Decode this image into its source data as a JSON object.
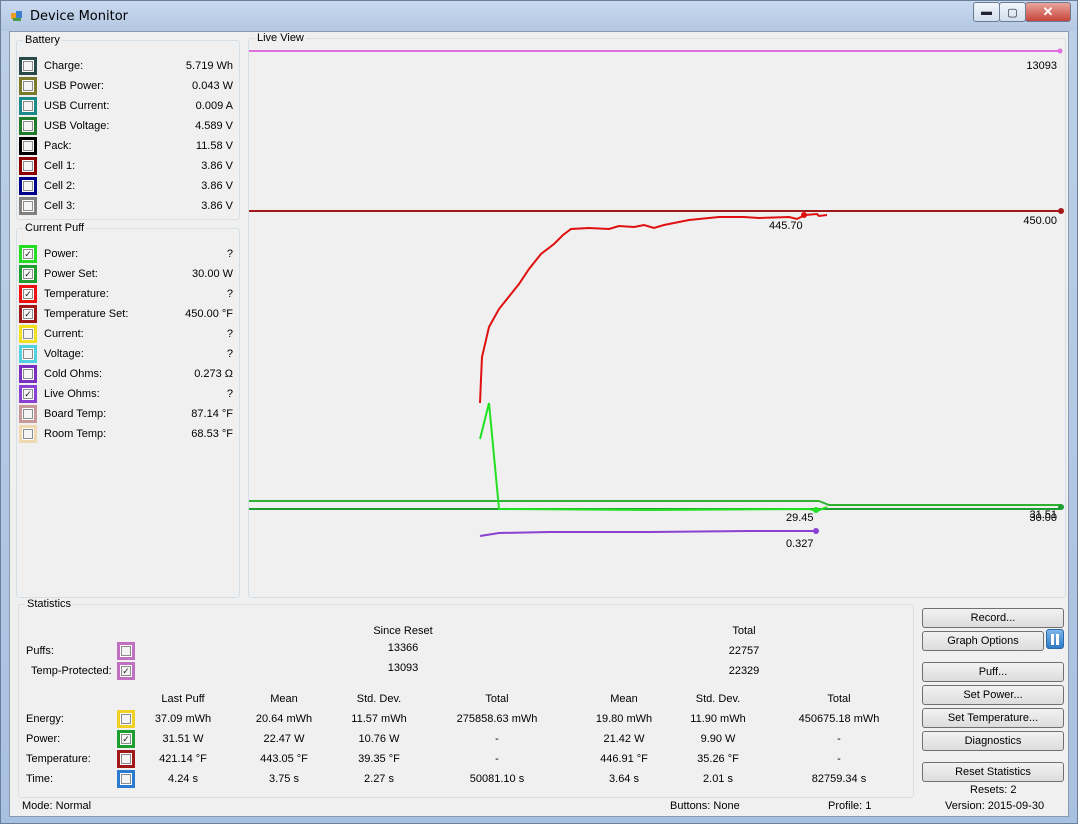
{
  "window": {
    "title": "Device Monitor",
    "minimize": "▬",
    "maximize": "▢",
    "close": "✕"
  },
  "battery": {
    "title": "Battery",
    "items": [
      {
        "label": "Charge:",
        "value": "5.719 Wh",
        "color": "#2a4a4a",
        "checked": false
      },
      {
        "label": "USB Power:",
        "value": "0.043 W",
        "color": "#7a7a2a",
        "checked": false
      },
      {
        "label": "USB Current:",
        "value": "0.009 A",
        "color": "#1a8a8a",
        "checked": false
      },
      {
        "label": "USB Voltage:",
        "value": "4.589 V",
        "color": "#1f7a2a",
        "checked": false
      },
      {
        "label": "Pack:",
        "value": "11.58 V",
        "color": "#000000",
        "checked": false
      },
      {
        "label": "Cell 1:",
        "value": "3.86 V",
        "color": "#8b0000",
        "checked": false
      },
      {
        "label": "Cell 2:",
        "value": "3.86 V",
        "color": "#00008b",
        "checked": false
      },
      {
        "label": "Cell 3:",
        "value": "3.86 V",
        "color": "#808080",
        "checked": false
      }
    ]
  },
  "puff": {
    "title": "Current Puff",
    "items": [
      {
        "label": "Power:",
        "value": "?",
        "color": "#22dd22",
        "checked": true
      },
      {
        "label": "Power Set:",
        "value": "30.00 W",
        "color": "#1e9e2e",
        "checked": true
      },
      {
        "label": "Temperature:",
        "value": "?",
        "color": "#ee1111",
        "checked": true
      },
      {
        "label": "Temperature Set:",
        "value": "450.00 °F",
        "color": "#a01818",
        "checked": true
      },
      {
        "label": "Current:",
        "value": "?",
        "color": "#f0e020",
        "checked": false
      },
      {
        "label": "Voltage:",
        "value": "?",
        "color": "#50d0e0",
        "checked": false
      },
      {
        "label": "Cold Ohms:",
        "value": "0.273 Ω",
        "color": "#7b2fbf",
        "checked": false
      },
      {
        "label": "Live Ohms:",
        "value": "?",
        "color": "#8a40d0",
        "checked": true
      },
      {
        "label": "Board Temp:",
        "value": "87.14 °F",
        "color": "#c89a9a",
        "checked": false
      },
      {
        "label": "Room Temp:",
        "value": "68.53 °F",
        "color": "#f0d8b0",
        "checked": false
      }
    ]
  },
  "live_view": {
    "title": "Live View",
    "labels": [
      "13093",
      "445.70",
      "450.00",
      "29.45",
      "31.51",
      "30.00",
      "0.327"
    ]
  },
  "statistics": {
    "title": "Statistics",
    "since_reset": "Since Reset",
    "total": "Total",
    "puffs_label": "Puffs:",
    "temp_protected_label": "Temp-Protected:",
    "puffs_since_reset": "13366",
    "puffs_total": "22757",
    "tp_since_reset": "13093",
    "tp_total": "22329",
    "columns": [
      "Last Puff",
      "Mean",
      "Std. Dev.",
      "Total",
      "Mean",
      "Std. Dev.",
      "Total"
    ],
    "rows": [
      {
        "label": "Energy:",
        "color": "#f0d020",
        "checked": false,
        "values": [
          "37.09 mWh",
          "20.64 mWh",
          "11.57 mWh",
          "275858.63 mWh",
          "19.80 mWh",
          "11.90 mWh",
          "450675.18 mWh"
        ]
      },
      {
        "label": "Power:",
        "color": "#1e9e2e",
        "checked": true,
        "values": [
          "31.51 W",
          "22.47 W",
          "10.76 W",
          "-",
          "21.42 W",
          "9.90 W",
          "-"
        ]
      },
      {
        "label": "Temperature:",
        "color": "#a01818",
        "checked": false,
        "values": [
          "421.14 °F",
          "443.05 °F",
          "39.35 °F",
          "-",
          "446.91 °F",
          "35.26 °F",
          "-"
        ]
      },
      {
        "label": "Time:",
        "color": "#2a7ad0",
        "checked": false,
        "values": [
          "4.24 s",
          "3.75 s",
          "2.27 s",
          "50081.10 s",
          "3.64 s",
          "2.01 s",
          "82759.34 s"
        ]
      }
    ]
  },
  "buttons": {
    "record": "Record...",
    "graph_options": "Graph Options",
    "puff": "Puff...",
    "set_power": "Set Power...",
    "set_temperature": "Set Temperature...",
    "diagnostics": "Diagnostics",
    "reset_statistics": "Reset Statistics",
    "resets": "Resets: 2"
  },
  "status": {
    "mode": "Mode: Normal",
    "buttons": "Buttons: None",
    "profile": "Profile: 1",
    "version": "Version: 2015-09-30"
  }
}
